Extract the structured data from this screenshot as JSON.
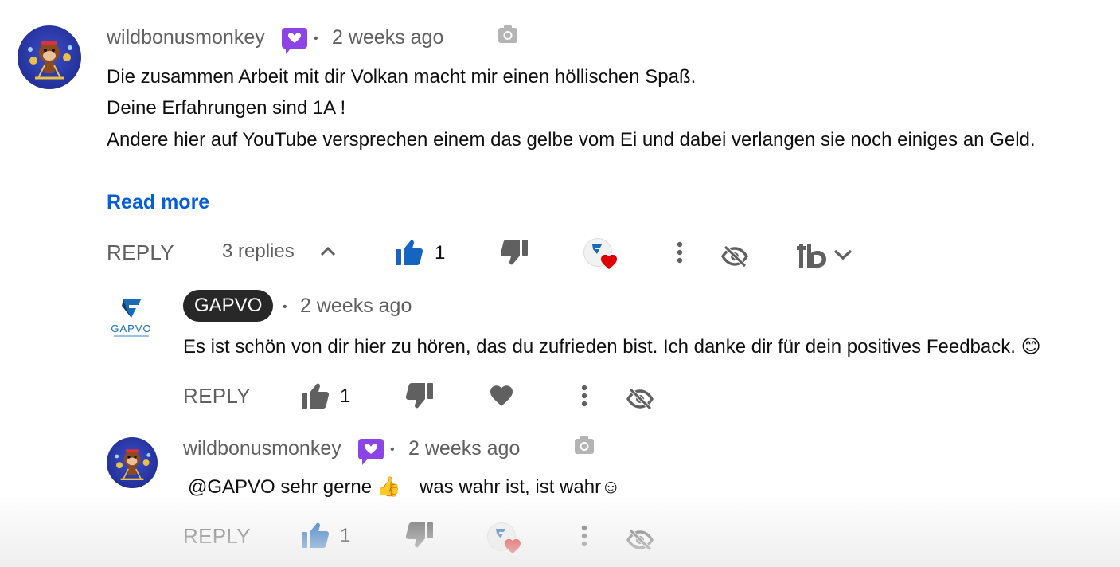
{
  "comment": {
    "author": "wildbonusmonkey",
    "time": "2 weeks ago",
    "lines": [
      "Die zusammen Arbeit mit dir Volkan macht mir einen höllischen Spaß.",
      "Deine Erfahrungen sind 1A !",
      "Andere hier auf YouTube versprechen einem das gelbe vom Ei und dabei verlangen sie noch einiges an Geld."
    ],
    "read_more": "Read more",
    "reply_label": "REPLY",
    "replies_label": "3 replies",
    "like_count": "1"
  },
  "replies": [
    {
      "author": "GAPVO",
      "time": "2 weeks ago",
      "text": "Es ist schön von dir hier zu hören, das du zufrieden bist. Ich danke dir für dein positives Feedback. 😊",
      "reply_label": "REPLY",
      "like_count": "1"
    },
    {
      "author": "wildbonusmonkey",
      "time": "2 weeks ago",
      "text_part1": "@GAPVO  sehr gerne 👍",
      "text_part2": "was wahr ist, ist wahr☺",
      "reply_label": "REPLY",
      "like_count": "1"
    }
  ],
  "logo_text": "GAPVO",
  "separator": "•",
  "colors": {
    "link_blue": "#065fd4",
    "like_active": "#1565c0",
    "muted": "#606060",
    "member_badge": "#8c44e6",
    "heart": "#e00000"
  },
  "icons": [
    "member-badge-icon",
    "camera-icon",
    "thumbs-up-icon",
    "thumbs-down-icon",
    "creator-heart-icon",
    "more-vert-icon",
    "hide-icon",
    "tubebuddy-icon",
    "chevron-up-icon",
    "chevron-down-icon",
    "heart-icon"
  ]
}
